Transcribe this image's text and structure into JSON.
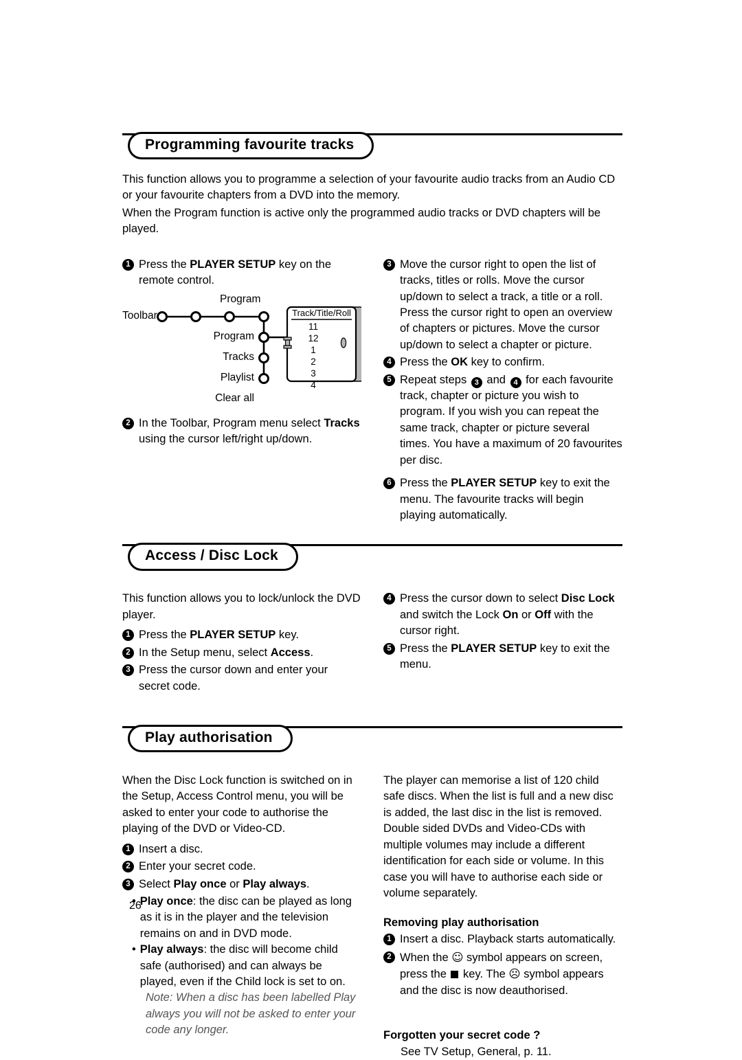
{
  "page": {
    "number": "26"
  },
  "sections": [
    {
      "id": "programming-favourite-tracks",
      "title": "Programming favourite tracks",
      "intro": [
        "This function allows you to programme a selection of your favourite audio tracks from an Audio CD or your favourite chapters from a DVD into the memory.",
        "When the Program function is active only the programmed audio tracks or DVD chapters will be played."
      ]
    },
    {
      "id": "access-disc-lock",
      "title": "Access / Disc Lock"
    },
    {
      "id": "play-authorisation",
      "title": "Play authorisation"
    }
  ],
  "programming": {
    "step1_pre": "Press the ",
    "step1_bold": "PLAYER SETUP",
    "step1_post": " key on the remote control.",
    "step2_pre": "In the Toolbar, Program menu select ",
    "step2_bold": "Tracks",
    "step2_post": " using the cursor left/right up/down.",
    "step3": "Move the cursor right to open the list of tracks, titles or rolls. Move the cursor up/down to select a track, a title or a roll. Press the cursor right to open an overview of chapters or pictures. Move the cursor up/down to select a chapter or picture.",
    "step4_pre": "Press the ",
    "step4_bold": "OK",
    "step4_post": " key to confirm.",
    "step5_a": "Repeat steps ",
    "step5_b": " and ",
    "step5_c": " for each favourite track, chapter or picture you wish to program. If you wish you can repeat the same track, chapter or picture several times. You have a maximum of 20 favourites per disc.",
    "step6_pre": "Press the ",
    "step6_bold": "PLAYER SETUP",
    "step6_post": " key to exit the menu. The favourite tracks will begin playing automatically."
  },
  "diagram": {
    "title": "Program",
    "toolbar_label": "Toolbar",
    "menu_items": [
      "Program",
      "Tracks",
      "Playlist",
      "Clear all"
    ],
    "list_header": "Track/Title/Roll",
    "list_items": [
      "11",
      "12",
      "1",
      "2",
      "3",
      "4"
    ]
  },
  "disc_lock": {
    "intro": "This function allows you to lock/unlock the DVD player.",
    "step1_pre": "Press the ",
    "step1_bold": "PLAYER SETUP",
    "step1_post": " key.",
    "step2_pre": "In the Setup menu, select ",
    "step2_bold": "Access",
    "step2_post": ".",
    "step3": "Press the cursor down and enter your secret code.",
    "step4_a": "Press the cursor down to select ",
    "step4_b": "Disc Lock",
    "step4_c": " and switch the Lock ",
    "step4_d": "On",
    "step4_e": " or ",
    "step4_f": "Off",
    "step4_g": " with the cursor right.",
    "step5_pre": "Press the ",
    "step5_bold": "PLAYER SETUP",
    "step5_post": " key to exit the menu."
  },
  "play_auth": {
    "intro": "When the Disc Lock function is switched on in the Setup, Access Control menu, you will be asked to enter your code to authorise the playing of the DVD or Video-CD.",
    "step1": "Insert a disc.",
    "step2": "Enter your secret code.",
    "step3_pre": "Select ",
    "step3_b1": "Play once",
    "step3_mid": " or ",
    "step3_b2": "Play always",
    "step3_post": ".",
    "bullet1_bold": "Play once",
    "bullet1_text": ": the disc can be played as long as it is in the player and the television remains on and in DVD mode.",
    "bullet2_bold": "Play always",
    "bullet2_text": ": the disc will become child safe (authorised) and can always be played, even if the Child lock is set to on.",
    "note": "Note: When a disc has been labelled Play always you will not be asked to enter your code any longer.",
    "right_para": "The player can memorise a list of 120 child safe discs. When the list is full and a new disc is added, the last disc in the list is removed. Double sided DVDs and Video-CDs with multiple volumes may include a different identification for each side or volume. In this case you will have to authorise each side or volume separately.",
    "removing_heading": "Removing play authorisation",
    "removing_step1": "Insert a disc. Playback starts automatically.",
    "removing_step2_a": "When the ",
    "removing_smiley": "☺",
    "removing_step2_b": " symbol appears on screen, press the ",
    "removing_stop_key": "stop-key",
    "removing_step2_c": " key. The ",
    "removing_frown": "☹",
    "removing_step2_d": " symbol appears and the disc is now deauthorised.",
    "forgotten_heading": "Forgotten your secret code ?",
    "forgotten_text": "See TV Setup, General, p. 11."
  },
  "markers": {
    "m1": "1",
    "m2": "2",
    "m3": "3",
    "m4": "4",
    "m5": "5",
    "m6": "6"
  },
  "colors": {
    "ink": "#000000",
    "paper": "#ffffff",
    "note_gray": "#555555",
    "panel_gray": "#b5b5b5"
  }
}
